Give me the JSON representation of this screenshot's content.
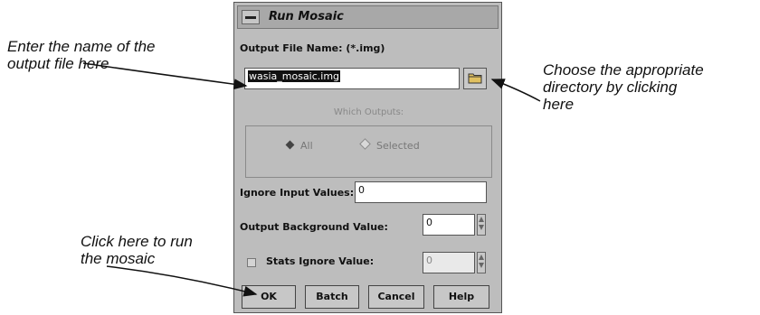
{
  "callouts": {
    "filename": [
      "Enter the name of the",
      "output file here"
    ],
    "directory": [
      "Choose the appropriate",
      "directory by clicking",
      "here"
    ],
    "run": [
      "Click here to run",
      "the mosaic"
    ]
  },
  "dialog": {
    "title": "Run Mosaic",
    "output_file_label": "Output File Name: (*.img)",
    "output_file_value": "wasia_mosaic.img",
    "which_outputs_label": "Which Outputs:",
    "radio_all": "All",
    "radio_selected": "Selected",
    "selected_option": "All",
    "ignore_input_label": "Ignore Input Values:",
    "ignore_input_value": "0",
    "output_background_label": "Output Background Value:",
    "output_background_value": "0",
    "stats_ignore_label": "Stats Ignore Value:",
    "stats_ignore_value": "0",
    "buttons": {
      "ok": "OK",
      "batch": "Batch",
      "cancel": "Cancel",
      "help": "Help"
    }
  }
}
